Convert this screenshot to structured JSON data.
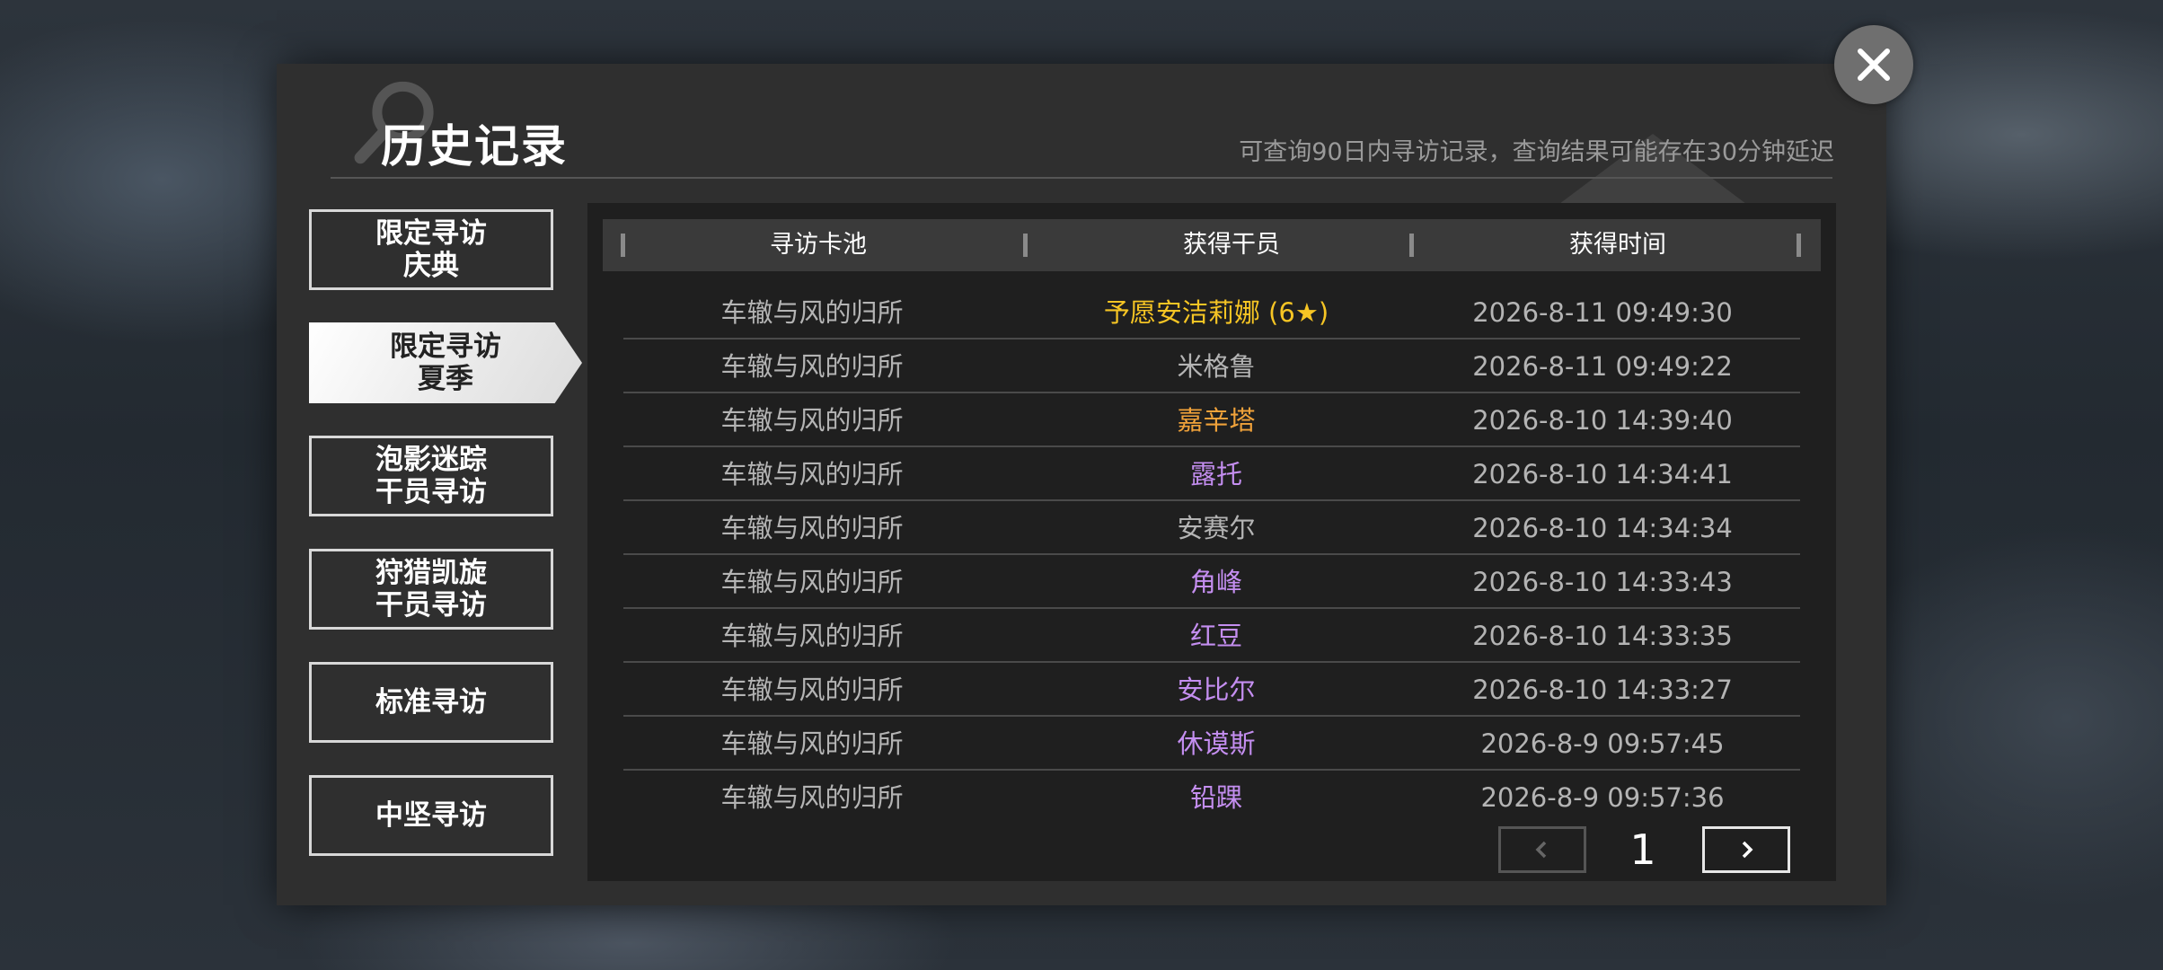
{
  "header": {
    "title": "历史记录",
    "hint": "可查询90日内寻访记录，查询结果可能存在30分钟延迟"
  },
  "tabs": [
    {
      "label": "限定寻访\n庆典",
      "active": false
    },
    {
      "label": "限定寻访\n夏季",
      "active": true
    },
    {
      "label": "泡影迷踪\n干员寻访",
      "active": false
    },
    {
      "label": "狩猎凯旋\n干员寻访",
      "active": false
    },
    {
      "label": "标准寻访",
      "active": false
    },
    {
      "label": "中坚寻访",
      "active": false
    }
  ],
  "table": {
    "columns": [
      "寻访卡池",
      "获得干员",
      "获得时间"
    ],
    "rows": [
      {
        "pool": "车辙与风的归所",
        "operator": "予愿安洁莉娜 (6★)",
        "time": "2026-8-11 09:49:30",
        "color": "#f6c524"
      },
      {
        "pool": "车辙与风的归所",
        "operator": "米格鲁",
        "time": "2026-8-11 09:49:22",
        "color": "#b4b4b4"
      },
      {
        "pool": "车辙与风的归所",
        "operator": "嘉辛塔",
        "time": "2026-8-10 14:39:40",
        "color": "#f0a23a"
      },
      {
        "pool": "车辙与风的归所",
        "operator": "露托",
        "time": "2026-8-10 14:34:41",
        "color": "#c48ef0"
      },
      {
        "pool": "车辙与风的归所",
        "operator": "安赛尔",
        "time": "2026-8-10 14:34:34",
        "color": "#b4b4b4"
      },
      {
        "pool": "车辙与风的归所",
        "operator": "角峰",
        "time": "2026-8-10 14:33:43",
        "color": "#c48ef0"
      },
      {
        "pool": "车辙与风的归所",
        "operator": "红豆",
        "time": "2026-8-10 14:33:35",
        "color": "#c48ef0"
      },
      {
        "pool": "车辙与风的归所",
        "operator": "安比尔",
        "time": "2026-8-10 14:33:27",
        "color": "#c48ef0"
      },
      {
        "pool": "车辙与风的归所",
        "operator": "休谟斯",
        "time": "2026-8-9 09:57:45",
        "color": "#c48ef0"
      },
      {
        "pool": "车辙与风的归所",
        "operator": "铅踝",
        "time": "2026-8-9 09:57:36",
        "color": "#c48ef0"
      }
    ]
  },
  "pager": {
    "page": "1",
    "prev_icon": "chevron-left-icon",
    "next_icon": "chevron-right-icon"
  },
  "close_icon": "close-icon",
  "colors": {
    "six_star": "#f6c524",
    "five_star": "#f0a23a",
    "four_star": "#c48ef0",
    "three_star": "#b4b4b4"
  }
}
